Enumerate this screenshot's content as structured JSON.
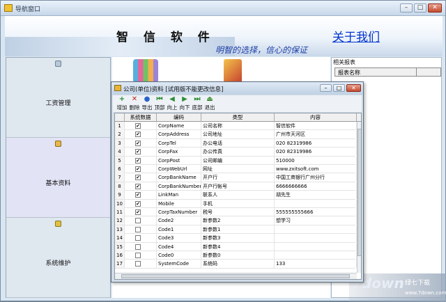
{
  "window": {
    "title": "导航窗口"
  },
  "banner": {
    "company": "智 信 软 件",
    "about": "关于我们",
    "slogan": "明智的选择，信心的保证"
  },
  "nav": [
    {
      "label": "工资管理",
      "icon": "database-icon"
    },
    {
      "label": "基本资料",
      "icon": "folder-icon"
    },
    {
      "label": "系统维护",
      "icon": "hammer-icon"
    }
  ],
  "right": {
    "title": "相关报表",
    "column": "报表名称"
  },
  "dialog": {
    "title": "公司(单位)资料  [试用版不能更改信息]",
    "toolbar": [
      {
        "label": "增加",
        "icon": "+",
        "color": "#1f8a2b"
      },
      {
        "label": "删除",
        "icon": "✕",
        "color": "#c0261a"
      },
      {
        "label": "导出",
        "icon": "●",
        "color": "#2a62c9"
      },
      {
        "label": "顶部",
        "icon": "⏮",
        "color": "#2f8f3a"
      },
      {
        "label": "向上",
        "icon": "◀",
        "color": "#2f8f3a"
      },
      {
        "label": "向下",
        "icon": "▶",
        "color": "#2f8f3a"
      },
      {
        "label": "底部",
        "icon": "⏭",
        "color": "#2f8f3a"
      },
      {
        "label": "退出",
        "icon": "⏏",
        "color": "#3a8a2f"
      }
    ],
    "columns": [
      "系统数据",
      "编码",
      "类型",
      "内容"
    ],
    "rows": [
      {
        "n": "1",
        "checked": true,
        "code": "CorpName",
        "type": "公司名称",
        "value": "智信软件"
      },
      {
        "n": "2",
        "checked": true,
        "code": "CorpAddress",
        "type": "公司地址",
        "value": "广州市天河区"
      },
      {
        "n": "3",
        "checked": true,
        "code": "CorpTel",
        "type": "办公电话",
        "value": "020 82319986"
      },
      {
        "n": "4",
        "checked": true,
        "code": "CorpFax",
        "type": "办公传真",
        "value": "020 82319986"
      },
      {
        "n": "5",
        "checked": true,
        "code": "CorpPost",
        "type": "公司邮编",
        "value": "510000"
      },
      {
        "n": "6",
        "checked": true,
        "code": "CorpWebUrl",
        "type": "网址",
        "value": "www.zxitsoft.com"
      },
      {
        "n": "7",
        "checked": true,
        "code": "CorpBankName",
        "type": "开户行",
        "value": "中国工商银行广州分行"
      },
      {
        "n": "8",
        "checked": true,
        "code": "CorpBankNumber",
        "type": "开户行帐号",
        "value": "6666666666"
      },
      {
        "n": "9",
        "checked": true,
        "code": "LinkMan",
        "type": "联系人",
        "value": "胡先生"
      },
      {
        "n": "10",
        "checked": true,
        "code": "Mobile",
        "type": "手机",
        "value": ""
      },
      {
        "n": "11",
        "checked": true,
        "code": "CorpTaxNumber",
        "type": "税号",
        "value": "555555555666"
      },
      {
        "n": "12",
        "checked": false,
        "code": "Code2",
        "type": "新参数2",
        "value": "想学习"
      },
      {
        "n": "13",
        "checked": false,
        "code": "Code1",
        "type": "新参数1",
        "value": ""
      },
      {
        "n": "14",
        "checked": false,
        "code": "Code3",
        "type": "新参数3",
        "value": ""
      },
      {
        "n": "15",
        "checked": false,
        "code": "Code4",
        "type": "新参数4",
        "value": ""
      },
      {
        "n": "16",
        "checked": false,
        "code": "Code0",
        "type": "新参数0",
        "value": ""
      },
      {
        "n": "17",
        "checked": false,
        "code": "SystemCode",
        "type": "系统码",
        "value": "133"
      }
    ]
  },
  "watermark": {
    "big": "7down",
    "site": "绿七下载",
    "url": "www.7down.com"
  }
}
